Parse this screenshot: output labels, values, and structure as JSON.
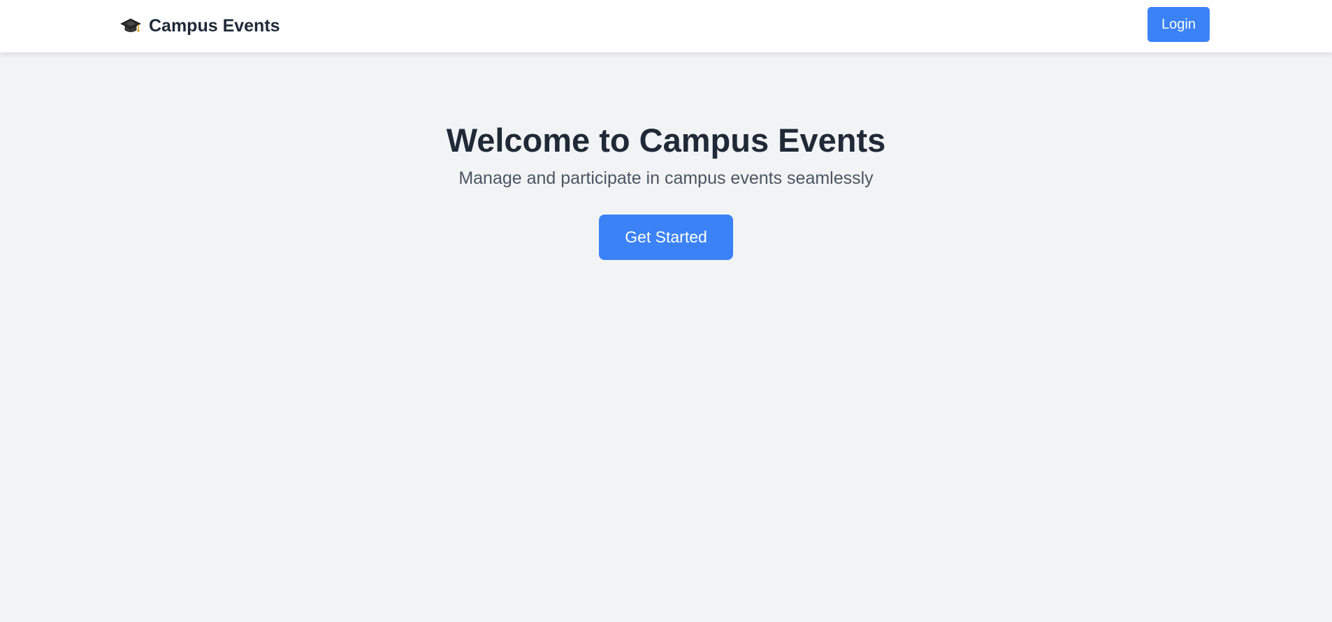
{
  "app": {
    "brand_name": "Campus Events",
    "brand_icon": "graduation-cap-icon"
  },
  "header": {
    "login_label": "Login"
  },
  "hero": {
    "title": "Welcome to Campus Events",
    "subtitle": "Manage and participate in campus events seamlessly",
    "cta_label": "Get Started"
  },
  "colors": {
    "accent": "#3b82f6",
    "page_background": "#f2f3f5",
    "text_primary": "#1f2937",
    "text_secondary": "#4b5563"
  }
}
